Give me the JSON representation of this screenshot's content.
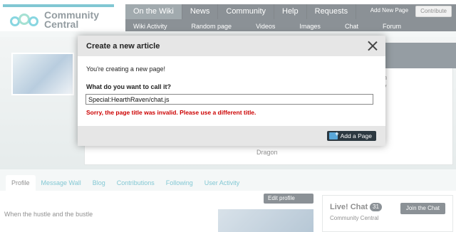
{
  "site": {
    "logo_line1": "Community",
    "logo_line2": "Central"
  },
  "nav": {
    "top": [
      "On the Wiki",
      "News",
      "Community",
      "Help",
      "Requests"
    ],
    "sub": [
      "Wiki Activity",
      "Random page",
      "Videos",
      "Images",
      "Chat",
      "Forum"
    ],
    "add_new_page": "Add New Page",
    "contribute": "Contribute"
  },
  "profile": {
    "behind_text_1": "n",
    "behind_text_2": "y",
    "behind_text_3": "Dragon",
    "tabs": [
      "Profile",
      "Message Wall",
      "Blog",
      "Contributions",
      "Following",
      "User Activity"
    ],
    "edit_profile": "Edit profile",
    "content_line_1": "When the hustle and the bustle"
  },
  "chat": {
    "title": "Live! Chat",
    "count": "31",
    "subtitle": "Community Central",
    "join_button": "Join the Chat"
  },
  "modal": {
    "title": "Create a new article",
    "intro": "You're creating a new page!",
    "question": "What do you want to call it?",
    "input_value": "Special:HearthRaven/chat.js",
    "error": "Sorry, the page title was invalid. Please use a different title.",
    "add_button": "Add a Page"
  }
}
